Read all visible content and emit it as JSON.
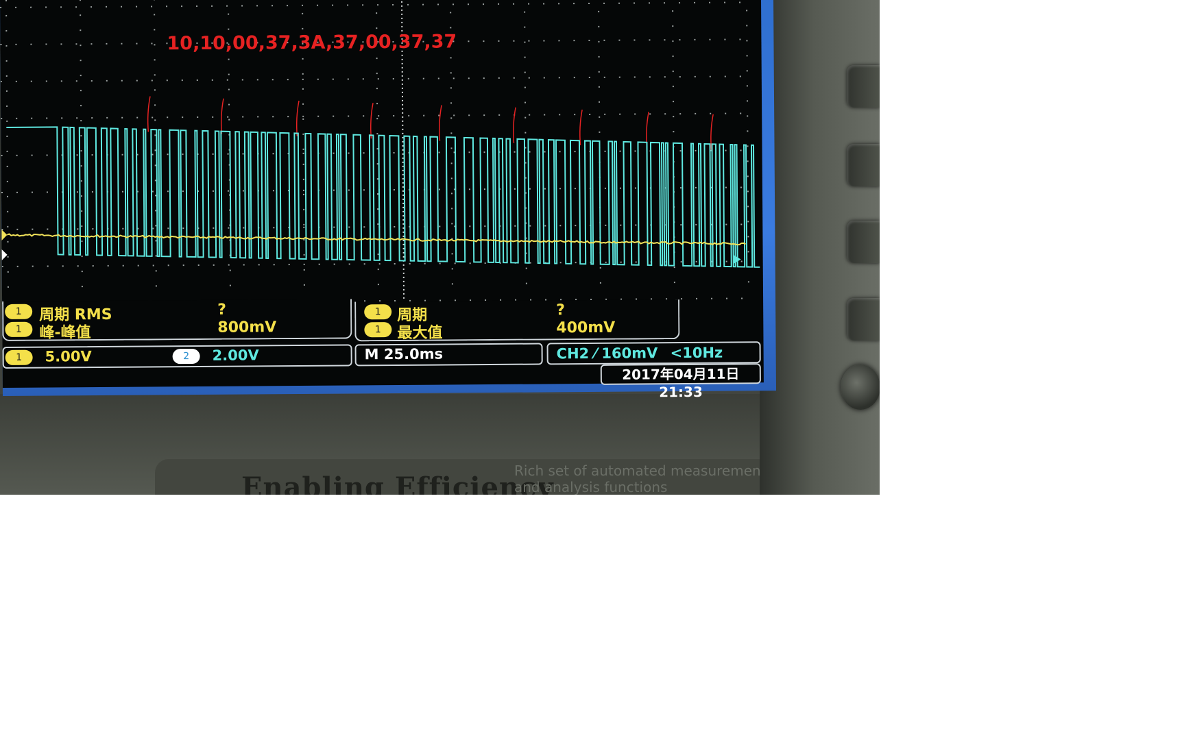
{
  "annotation": "10,10,00,37,3A,37,00,37,37",
  "measurements": {
    "left": {
      "rows": [
        {
          "channel": "1",
          "label": "周期 RMS",
          "value": "?"
        },
        {
          "channel": "1",
          "label": "峰-峰值",
          "value": "800mV"
        }
      ]
    },
    "right": {
      "rows": [
        {
          "channel": "1",
          "label": "周期",
          "value": "?"
        },
        {
          "channel": "1",
          "label": "最大值",
          "value": "400mV"
        }
      ]
    }
  },
  "status": {
    "ch1_channel": "1",
    "ch1_scale": "5.00V",
    "ch2_channel": "2",
    "ch2_scale": "2.00V",
    "timebase": "M 25.0ms",
    "trigger": "CH2 ⁄ 160mV",
    "trigger_freq": "<10Hz"
  },
  "datetime": "2017年04月11日 21:33",
  "bezel": {
    "slogan": "Enabling Efficiency",
    "note_line1": "Rich set of automated measurements",
    "note_line2": "and analysis functions"
  },
  "colors": {
    "ch1_trace": "#f2e35a",
    "ch2_trace": "#5fe8e0",
    "annotation": "#e62222",
    "frame": "#3a7be0"
  }
}
